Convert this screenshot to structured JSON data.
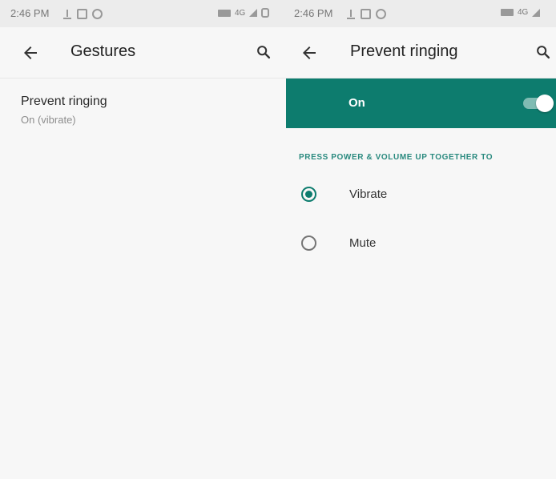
{
  "colors": {
    "accent": "#0d7c6e",
    "background": "#f7f7f7",
    "status_bar": "#ececec",
    "section_header": "#2a8a7f"
  },
  "left_screen": {
    "status_bar": {
      "time": "2:46 PM",
      "network": "4G",
      "icons": [
        "upload-icon",
        "screenshot-icon",
        "sync-icon",
        "battery-icon",
        "signal-icon",
        "alarm-icon"
      ]
    },
    "toolbar": {
      "back_icon": "arrow-back-icon",
      "title": "Gestures",
      "search_icon": "search-icon"
    },
    "items": [
      {
        "title": "Prevent ringing",
        "summary": "On (vibrate)"
      }
    ]
  },
  "right_screen": {
    "status_bar": {
      "time": "2:46 PM",
      "network": "4G",
      "icons": [
        "upload-icon",
        "screenshot-icon",
        "sync-icon",
        "battery-icon",
        "signal-icon"
      ]
    },
    "toolbar": {
      "back_icon": "arrow-back-icon",
      "title": "Prevent ringing",
      "search_icon": "search-icon"
    },
    "master_switch": {
      "label": "On",
      "checked": true
    },
    "section_header": "PRESS POWER & VOLUME UP TOGETHER TO",
    "options": [
      {
        "label": "Vibrate",
        "selected": true
      },
      {
        "label": "Mute",
        "selected": false
      }
    ]
  }
}
